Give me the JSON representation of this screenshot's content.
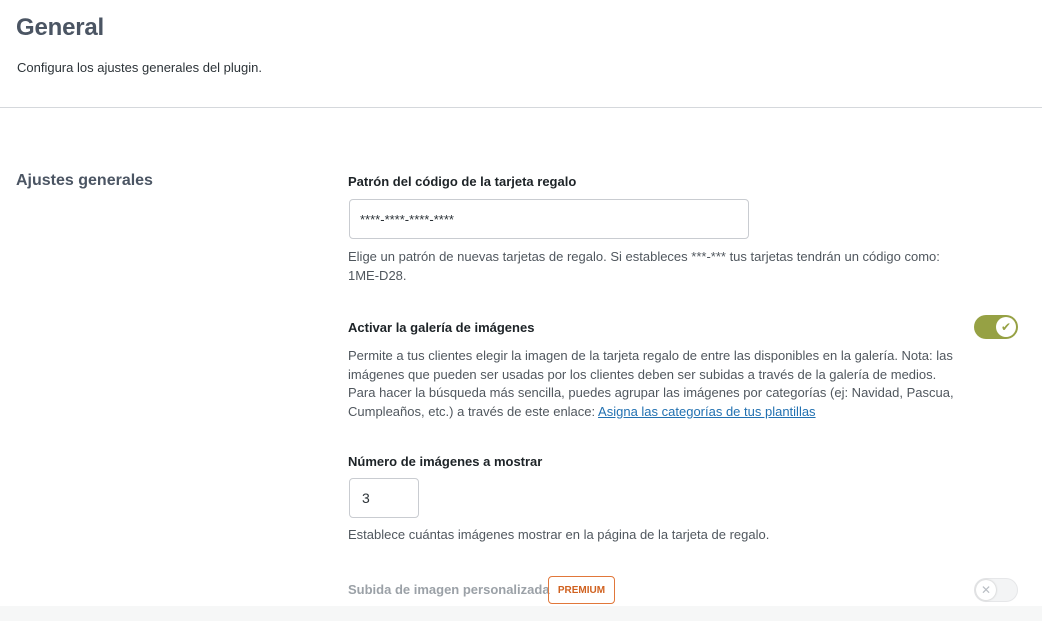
{
  "header": {
    "title": "General",
    "subtitle": "Configura los ajustes generales del plugin."
  },
  "section": {
    "title": "Ajustes generales"
  },
  "fields": {
    "code_pattern": {
      "label": "Patrón del código de la tarjeta regalo",
      "value": "****-****-****-****",
      "desc_line1": "Elige un patrón de nuevas tarjetas de regalo. Si estableces ***-*** tus tarjetas tendrán un código como:",
      "desc_line2": "1ME-D28."
    },
    "gallery": {
      "label": "Activar la galería de imágenes",
      "enabled": true,
      "desc_line1": "Permite a tus clientes elegir la imagen de la tarjeta regalo de entre las disponibles en la galería. Nota: las",
      "desc_line2": "imágenes que pueden ser usadas por los clientes deben ser subidas a través de la galería de medios.",
      "desc_line3": "Para hacer la búsqueda más sencilla, puedes agrupar las imágenes por categorías (ej: Navidad, Pascua,",
      "desc_line4": "Cumpleaños, etc.) a través de este enlace:",
      "link": "Asigna las categorías de tus plantillas"
    },
    "images_count": {
      "label": "Número de imágenes a mostrar",
      "value": "3",
      "desc": "Establece cuántas imágenes mostrar en la página de la tarjeta de regalo."
    },
    "custom_upload": {
      "label": "Subida de imagen personalizada",
      "badge": "PREMIUM",
      "enabled": false
    }
  },
  "colors": {
    "accent": "#96a144",
    "premium": "#e1773a",
    "link": "#2271b1"
  },
  "icons": {
    "toggle_on": "check-icon",
    "toggle_off": "close-icon"
  }
}
